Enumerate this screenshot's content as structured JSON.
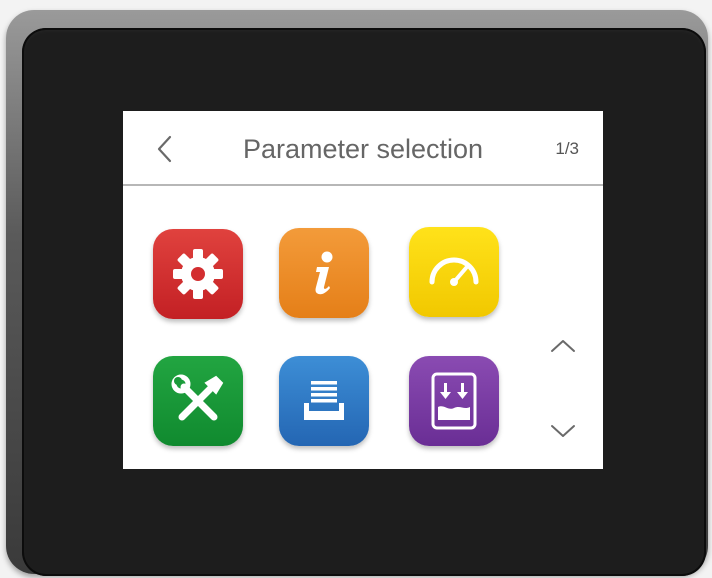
{
  "header": {
    "title": "Parameter selection",
    "page_indicator": "1/3"
  },
  "icons": {
    "back": "chevron-left-icon",
    "scroll_up": "chevron-up-icon",
    "scroll_down": "chevron-down-icon"
  },
  "tiles": [
    {
      "icon": "gear-icon",
      "color": "#d32e30"
    },
    {
      "icon": "info-icon",
      "color": "#ee8c28"
    },
    {
      "icon": "gauge-icon",
      "color": "#fbd50a"
    },
    {
      "icon": "tools-icon",
      "color": "#1a9a3a"
    },
    {
      "icon": "archive-tray-icon",
      "color": "#307ac6"
    },
    {
      "icon": "import-download-icon",
      "color": "#7a3ca4"
    }
  ]
}
